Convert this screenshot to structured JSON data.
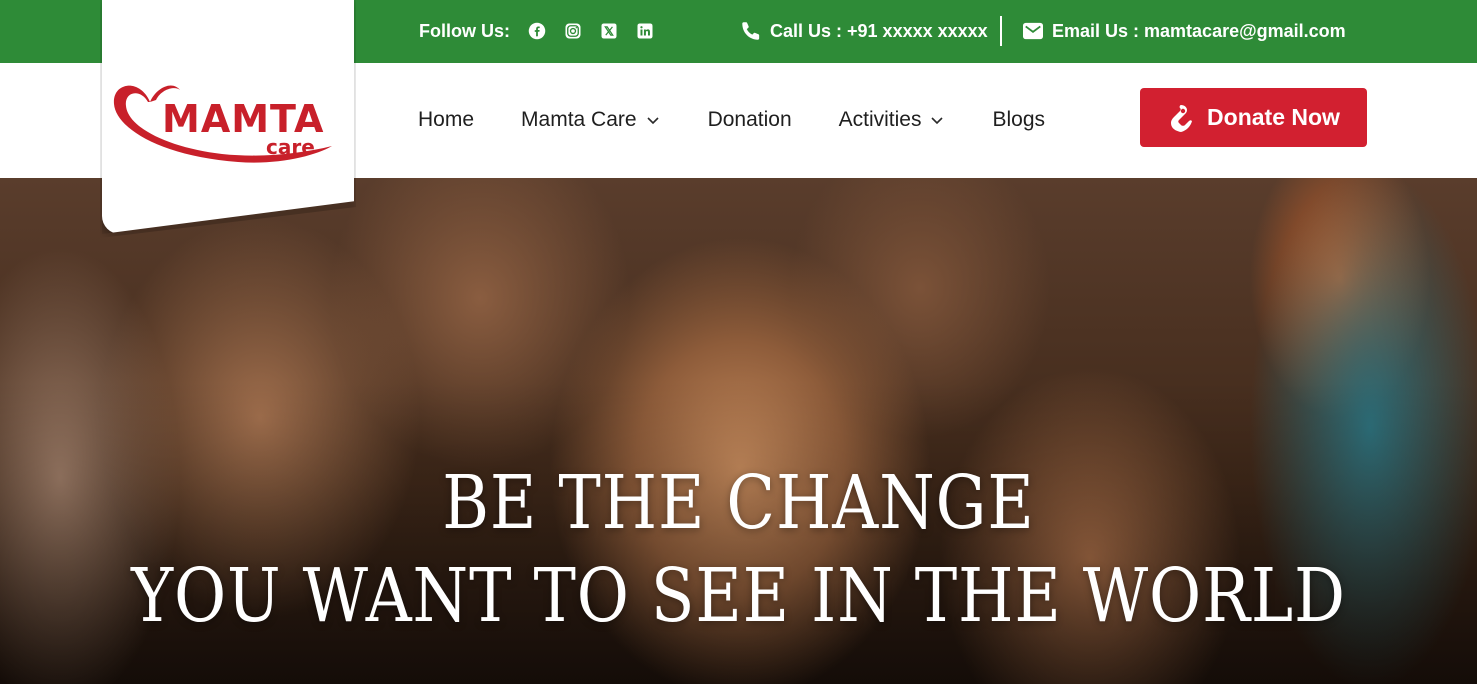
{
  "topbar": {
    "follow_label": "Follow Us:",
    "socials": [
      "facebook-icon",
      "instagram-icon",
      "x-twitter-icon",
      "linkedin-icon"
    ],
    "call_text": "Call Us : +91 xxxxx xxxxx",
    "email_text": "Email Us : mamtacare@gmail.com",
    "bg_color": "#2e8b37"
  },
  "logo": {
    "wordmark": "MAMTA",
    "subword": "care",
    "brand_color": "#c8202a"
  },
  "nav": {
    "items": [
      {
        "label": "Home",
        "has_dropdown": false
      },
      {
        "label": "Mamta Care",
        "has_dropdown": true
      },
      {
        "label": "Donation",
        "has_dropdown": false
      },
      {
        "label": "Activities",
        "has_dropdown": true
      },
      {
        "label": "Blogs",
        "has_dropdown": false
      }
    ],
    "donate_label": "Donate Now",
    "donate_color": "#d22030"
  },
  "hero": {
    "line1": "BE THE CHANGE",
    "line2": "YOU WANT TO SEE IN THE WORLD"
  }
}
